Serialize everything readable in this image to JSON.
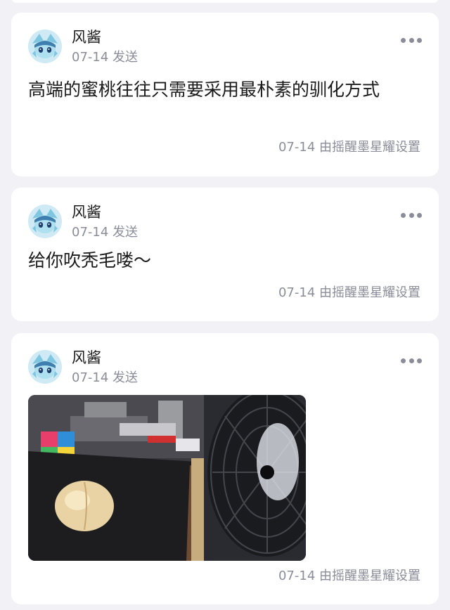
{
  "posts": [
    {
      "username": "风酱",
      "post_time": "07-14 发送",
      "text": "高端的蜜桃往往只需要采用最朴素的驯化方式",
      "footer": "07-14 由摇醒墨星耀设置"
    },
    {
      "username": "风酱",
      "post_time": "07-14 发送",
      "text": "给你吹秃毛喽～",
      "footer": "07-14 由摇醒墨星耀设置"
    },
    {
      "username": "风酱",
      "post_time": "07-14 发送",
      "footer": "07-14 由摇醒墨星耀设置"
    }
  ]
}
